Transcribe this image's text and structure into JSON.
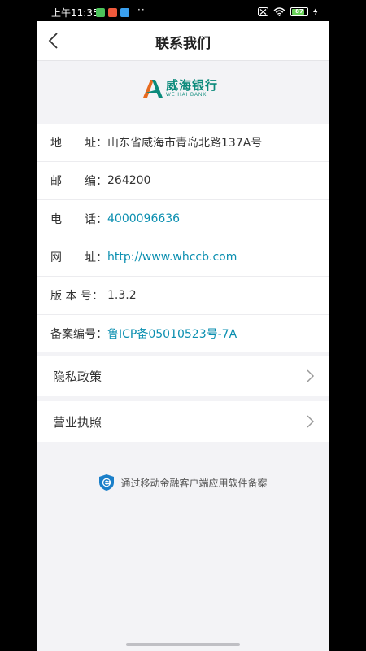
{
  "status_bar": {
    "time": "上午11:35",
    "battery": "87",
    "dots": "··"
  },
  "nav": {
    "title": "联系我们",
    "back_icon": "chevron-left-icon"
  },
  "logo": {
    "name_cn": "威海银行",
    "name_en": "WEIHAI BANK"
  },
  "info": [
    {
      "label": "地　　址：",
      "value": "山东省威海市青岛北路137A号",
      "link": false
    },
    {
      "label": "邮　　编：",
      "value": "264200",
      "link": false
    },
    {
      "label": "电　　话：",
      "value": "4000096636",
      "link": true
    },
    {
      "label": "网　　址：",
      "value": "http://www.whccb.com",
      "link": true
    },
    {
      "label": "版 本 号：",
      "value": "1.3.2",
      "link": false
    },
    {
      "label": "备案编号：",
      "value": "鲁ICP备05010523号-7A",
      "link": true
    }
  ],
  "menu": [
    {
      "label": "隐私政策",
      "icon": "chevron-right-icon"
    },
    {
      "label": "营业执照",
      "icon": "chevron-right-icon"
    }
  ],
  "footer": {
    "text": "通过移动金融客户端应用软件备案",
    "icon": "shield-e-icon"
  },
  "colors": {
    "accent": "#0b8fb0",
    "brand": "#0b8a7b",
    "background": "#f3f3f6"
  }
}
